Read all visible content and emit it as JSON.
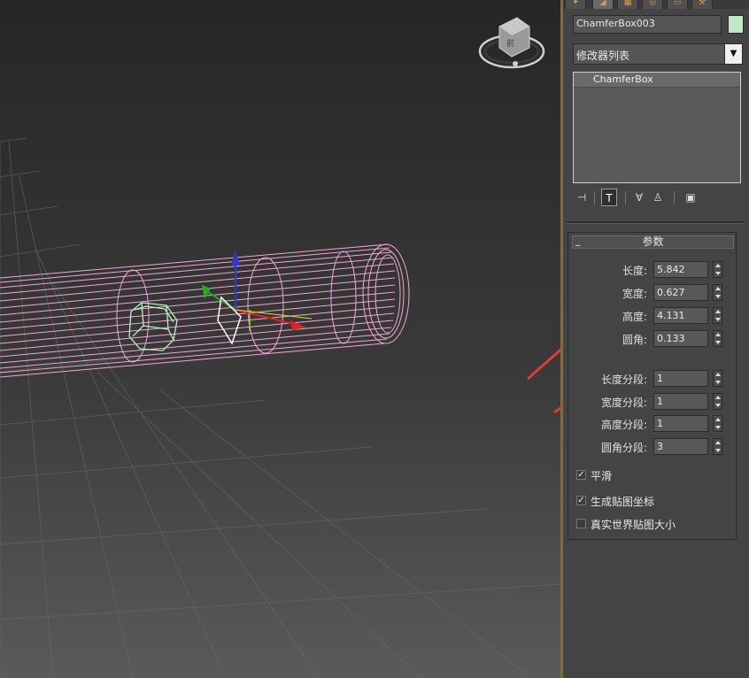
{
  "viewport": {
    "grid_color": "#6a6a6a",
    "wire_color": "#f0a8d4",
    "selected_color": "#b8f0c0",
    "arrow_color": "#e83a2a"
  },
  "panel": {
    "tabs": [
      {
        "icon": "create-tab-icon"
      },
      {
        "icon": "modify-tab-icon"
      },
      {
        "icon": "hierarchy-tab-icon"
      },
      {
        "icon": "motion-tab-icon"
      },
      {
        "icon": "display-tab-icon"
      },
      {
        "icon": "utilities-tab-icon"
      }
    ],
    "object_name": "ChamferBox003",
    "object_color": "#bfe8c6",
    "modifier_list": "修改器列表",
    "stack_items": [
      "ChamferBox"
    ],
    "rollout_title": "参数",
    "params": [
      {
        "label": "长度:",
        "value": "5.842"
      },
      {
        "label": "宽度:",
        "value": "0.627"
      },
      {
        "label": "高度:",
        "value": "4.131"
      },
      {
        "label": "圆角:",
        "value": "0.133"
      },
      {
        "label": "长度分段:",
        "value": "1"
      },
      {
        "label": "宽度分段:",
        "value": "1"
      },
      {
        "label": "高度分段:",
        "value": "1"
      },
      {
        "label": "圆角分段:",
        "value": "3"
      }
    ],
    "checkboxes": [
      {
        "label": "平滑",
        "checked": true
      },
      {
        "label": "生成贴图坐标",
        "checked": true
      },
      {
        "label": "真实世界贴图大小",
        "checked": false
      }
    ]
  }
}
